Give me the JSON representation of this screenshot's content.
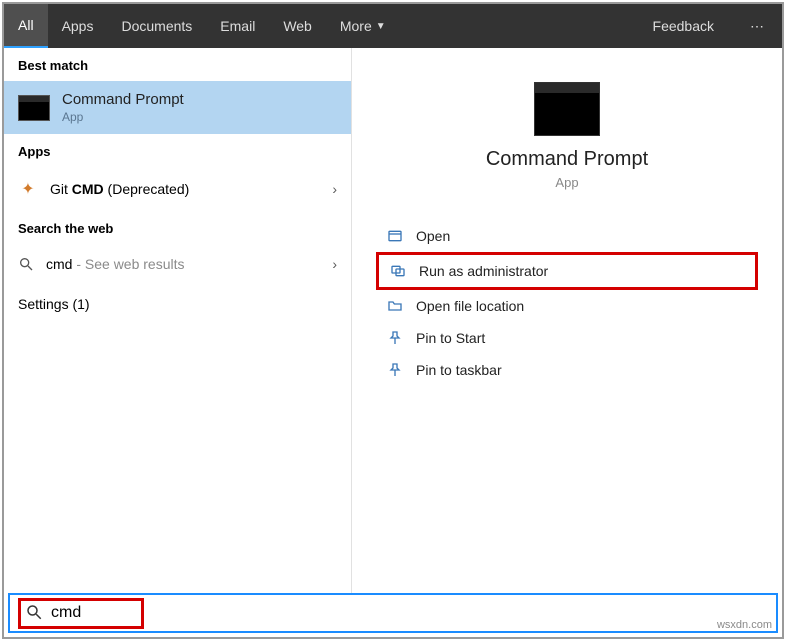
{
  "header": {
    "tabs": [
      "All",
      "Apps",
      "Documents",
      "Email",
      "Web",
      "More"
    ],
    "feedback": "Feedback"
  },
  "left": {
    "best_match_header": "Best match",
    "best_match": {
      "title": "Command Prompt",
      "subtitle": "App"
    },
    "apps_header": "Apps",
    "git": {
      "prefix": "Git ",
      "bold": "CMD",
      "suffix": " (Deprecated)"
    },
    "search_web_header": "Search the web",
    "web": {
      "term": "cmd",
      "suffix": " - See web results"
    },
    "settings": {
      "label": "Settings (1)"
    }
  },
  "right": {
    "title": "Command Prompt",
    "subtitle": "App",
    "actions": {
      "open": "Open",
      "run_admin": "Run as administrator",
      "open_loc": "Open file location",
      "pin_start": "Pin to Start",
      "pin_taskbar": "Pin to taskbar"
    }
  },
  "search": {
    "value": "cmd"
  },
  "watermark": "wsxdn.com"
}
